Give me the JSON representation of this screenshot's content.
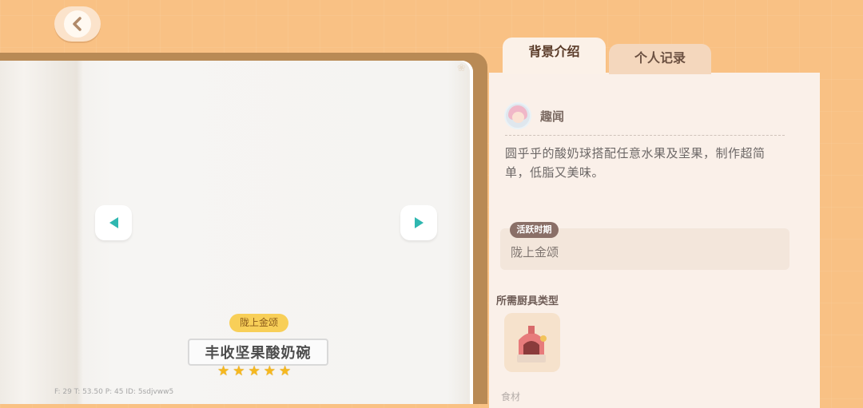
{
  "nav": {
    "back_icon": "back-arrow-icon"
  },
  "book": {
    "era_badge": "陇上金颂",
    "dish_name": "丰收坚果酸奶碗",
    "stars": [
      "★",
      "★",
      "★",
      "★",
      "★"
    ],
    "debug_text": "F: 29    T: 53.50    P: 45    ID: 5sdjvww5"
  },
  "tabs": [
    {
      "label": "背景介绍",
      "active": true
    },
    {
      "label": "个人记录",
      "active": false
    }
  ],
  "info": {
    "section_title": "趣闻",
    "description": "圆乎乎的酸奶球搭配任意水果及坚果，制作超简单，低脂又美味。",
    "period_tag": "活跃时期",
    "period_value": "陇上金颂",
    "tool_label": "所需厨具类型",
    "bottom_partial": "食材"
  },
  "colors": {
    "background": "#f9c184",
    "accent": "#2fb7b0",
    "star": "#f6b81e"
  }
}
